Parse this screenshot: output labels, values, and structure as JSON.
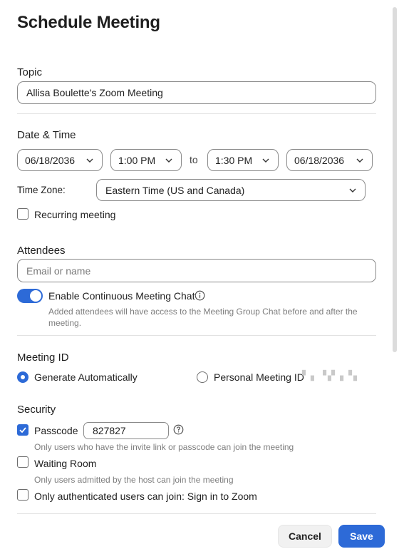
{
  "dialog": {
    "title": "Schedule Meeting"
  },
  "topic": {
    "label": "Topic",
    "value": "Allisa Boulette's Zoom Meeting"
  },
  "datetime": {
    "label": "Date & Time",
    "start_date": "06/18/2036",
    "start_time": "1:00 PM",
    "to_label": "to",
    "end_time": "1:30 PM",
    "end_date": "06/18/2036",
    "timezone_label": "Time Zone:",
    "timezone_value": "Eastern Time (US and Canada)",
    "recurring_label": "Recurring meeting"
  },
  "attendees": {
    "label": "Attendees",
    "placeholder": "Email or name",
    "continuous_chat_label": "Enable Continuous Meeting Chat",
    "continuous_chat_hint": "Added attendees will have access to the Meeting Group Chat before and after the meeting."
  },
  "meeting_id": {
    "label": "Meeting ID",
    "option_auto": "Generate Automatically",
    "option_personal": "Personal Meeting ID",
    "personal_masked": "▘▖▝▞▗▝▖"
  },
  "security": {
    "label": "Security",
    "passcode_label": "Passcode",
    "passcode_value": "827827",
    "passcode_hint": "Only users who have the invite link or passcode can join the meeting",
    "waiting_room_label": "Waiting Room",
    "waiting_room_hint": "Only users admitted by the host can join the meeting",
    "auth_label": "Only authenticated users can join: Sign in to Zoom"
  },
  "footer": {
    "cancel_label": "Cancel",
    "save_label": "Save"
  },
  "colors": {
    "accent": "#2d6ad7"
  }
}
